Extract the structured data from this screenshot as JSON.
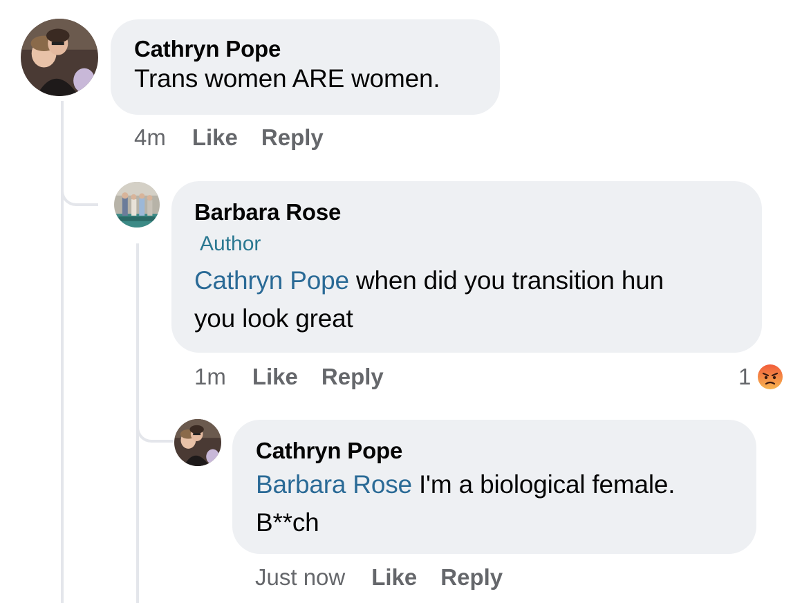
{
  "comments": [
    {
      "author": "Cathryn Pope",
      "text": "Trans women ARE women.",
      "time": "4m",
      "like": "Like",
      "reply": "Reply"
    },
    {
      "author": "Barbara Rose",
      "badge": "Author",
      "mention": "Cathryn Pope",
      "text_line1": " when did you transition hun",
      "text_line2": "you look great",
      "time": "1m",
      "like": "Like",
      "reply": "Reply",
      "reaction_count": "1",
      "reaction_icon": "angry-emoji-icon"
    },
    {
      "author": "Cathryn Pope",
      "mention": "Barbara Rose",
      "text_line1": " I'm a biological female.",
      "text_line2": "B**ch",
      "time": "Just now",
      "like": "Like",
      "reply": "Reply"
    }
  ],
  "colors": {
    "bubble": "#eef0f3",
    "mention": "#2a6a96",
    "author_badge": "#2a7891",
    "meta": "#65676b",
    "thread_line": "#e4e6eb",
    "angry_reaction": "#f0643c"
  }
}
